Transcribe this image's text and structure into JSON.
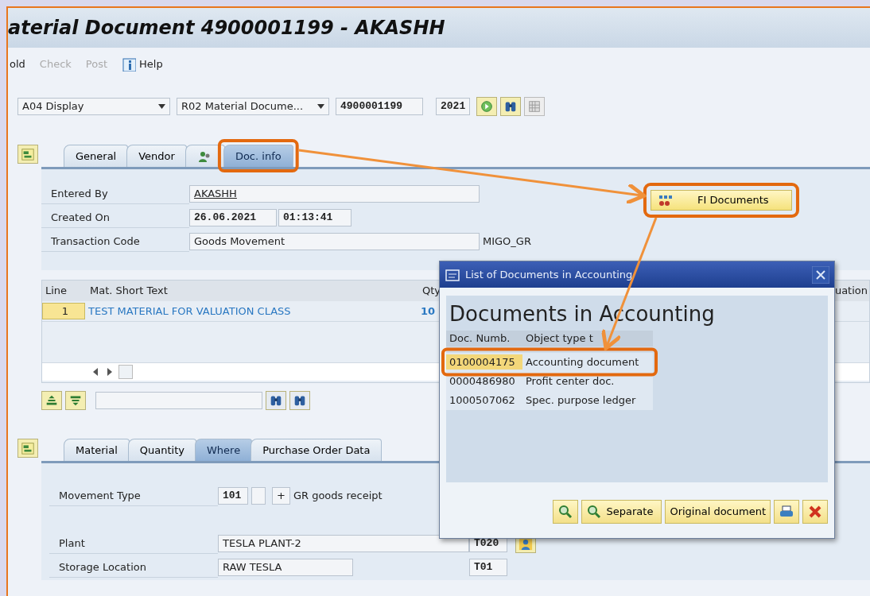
{
  "window": {
    "title": "aterial Document 4900001199 - AKASHH"
  },
  "toolbar": [
    {
      "label": "old",
      "disabled": false,
      "kind": "text"
    },
    {
      "label": "Check",
      "disabled": true,
      "kind": "text"
    },
    {
      "label": "Post",
      "disabled": true,
      "kind": "text"
    },
    {
      "label": "Help",
      "disabled": false,
      "kind": "help"
    }
  ],
  "selectors": {
    "action": "A04 Display",
    "reference": "R02 Material Docume...",
    "document": "4900001199",
    "year": "2021"
  },
  "header_tabs": [
    {
      "kind": "text",
      "label": "General",
      "selected": false
    },
    {
      "kind": "text",
      "label": "Vendor",
      "selected": false
    },
    {
      "kind": "icon",
      "selected": false
    },
    {
      "kind": "text",
      "label": "Doc. info",
      "selected": true
    }
  ],
  "doc_info": {
    "fields": [
      {
        "label": "Entered By",
        "values": [
          "AKASHH"
        ]
      },
      {
        "label": "Created On",
        "values": [
          "26.06.2021",
          "01:13:41"
        ]
      },
      {
        "label": "Transaction Code",
        "values": [
          "Goods Movement"
        ],
        "suffix": "MIGO_GR"
      }
    ],
    "button": "FI Documents"
  },
  "items_table": {
    "columns": [
      "Line",
      "Mat. Short Text",
      "Qty",
      "uation"
    ],
    "rows": [
      {
        "cells": [
          "1",
          "TEST MATERIAL FOR VALUATION CLASS",
          "10"
        ]
      }
    ]
  },
  "detail_tabs": [
    {
      "label": "Material",
      "selected": false
    },
    {
      "label": "Quantity",
      "selected": false
    },
    {
      "label": "Where",
      "selected": true
    },
    {
      "label": "Purchase Order Data",
      "selected": false
    }
  ],
  "where": {
    "movement": {
      "label": "Movement Type",
      "code": "101",
      "sign": "+",
      "text": "GR goods receipt"
    },
    "plant": {
      "label": "Plant",
      "name": "TESLA PLANT-2",
      "code": "T020"
    },
    "storage": {
      "label": "Storage Location",
      "name": "RAW TESLA",
      "code": "T01"
    }
  },
  "dialog": {
    "title": "List of Documents in Accounting",
    "heading": "Documents in Accounting",
    "columns": [
      "Doc. Numb.",
      "Object type t"
    ],
    "rows": [
      {
        "cells": [
          "0100004175",
          "Accounting document"
        ],
        "selected": true
      },
      {
        "cells": [
          "0000486980",
          "Profit center doc."
        ],
        "selected": false
      },
      {
        "cells": [
          "1000507062",
          "Spec. purpose ledger"
        ],
        "selected": false
      }
    ],
    "buttons": [
      {
        "kind": "detail"
      },
      {
        "kind": "separate",
        "label": "Separate"
      },
      {
        "kind": "original",
        "label": "Original document"
      },
      {
        "kind": "print"
      },
      {
        "kind": "cancel"
      }
    ]
  }
}
